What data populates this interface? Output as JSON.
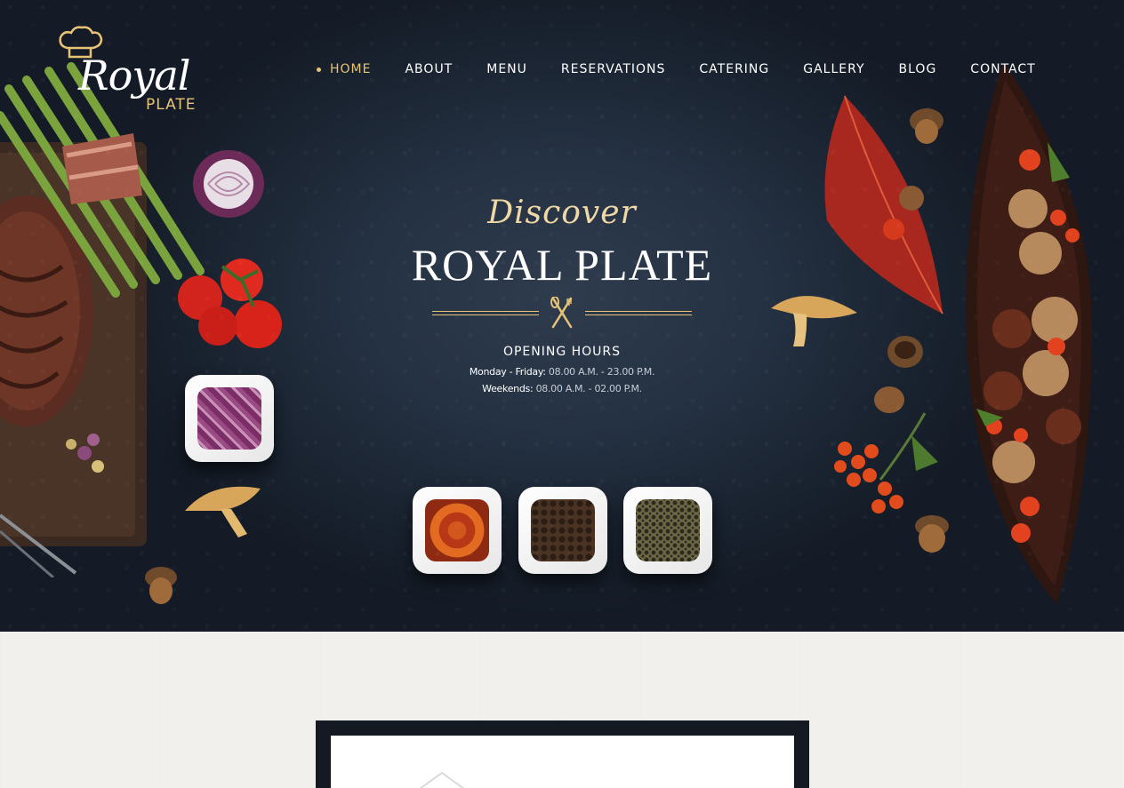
{
  "brand": {
    "logo_word": "Royal",
    "logo_sub": "PLATE"
  },
  "nav": {
    "items": [
      {
        "label": "HOME",
        "active": true
      },
      {
        "label": "ABOUT",
        "active": false
      },
      {
        "label": "MENU",
        "active": false
      },
      {
        "label": "RESERVATIONS",
        "active": false
      },
      {
        "label": "CATERING",
        "active": false
      },
      {
        "label": "GALLERY",
        "active": false
      },
      {
        "label": "BLOG",
        "active": false
      },
      {
        "label": "CONTACT",
        "active": false
      }
    ]
  },
  "hero": {
    "script_title": "Discover",
    "title": "ROYAL PLATE",
    "hours_title": "OPENING HOURS",
    "hours": [
      {
        "label": "Monday - Friday:",
        "value": "08.00 A.M. - 23.00 P.M."
      },
      {
        "label": "Weekends:",
        "value": "08.00 A.M. - 02.00 P.M."
      }
    ]
  },
  "colors": {
    "accent_gold": "#e6c375",
    "hero_bg": "#243142",
    "frame_dark": "#151a22"
  },
  "icons": [
    "chef-hat-icon",
    "cutlery-icon"
  ]
}
